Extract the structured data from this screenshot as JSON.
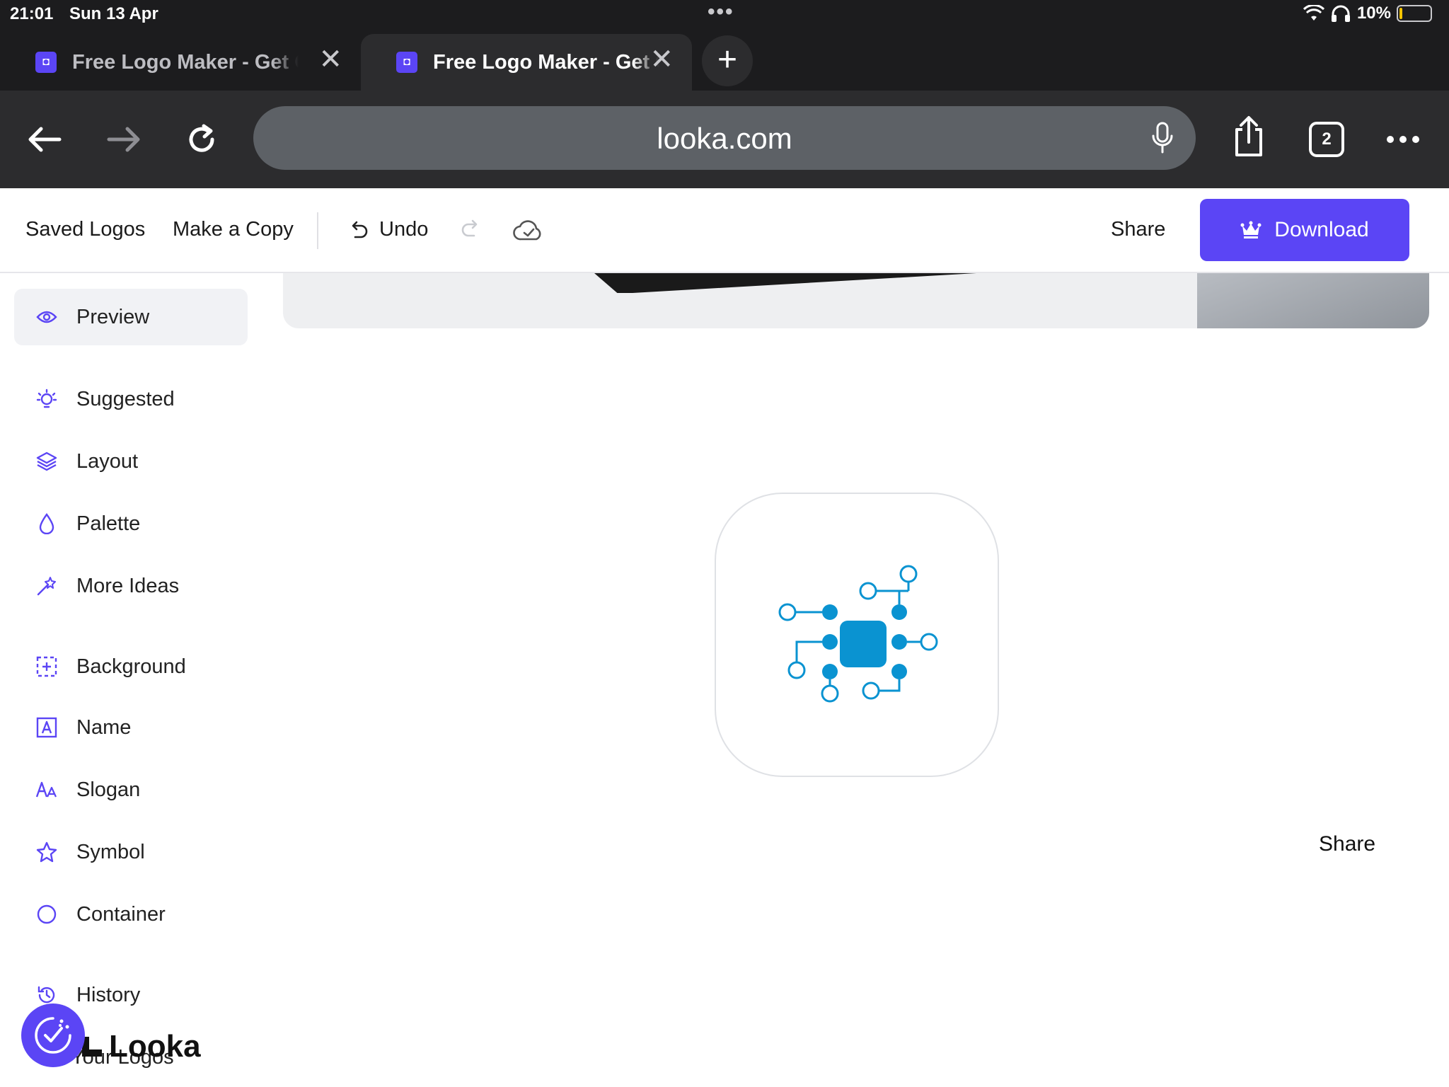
{
  "status_bar": {
    "time": "21:01",
    "date": "Sun 13 Apr",
    "battery": "10%",
    "battery_level": 0.1
  },
  "tabs": [
    {
      "title": "Free Logo Maker - Get C",
      "active": false
    },
    {
      "title": "Free Logo Maker - Get C",
      "active": true
    }
  ],
  "toolbar": {
    "address": "looka.com",
    "tab_count": "2"
  },
  "app_bar": {
    "saved_logos": "Saved Logos",
    "make_copy": "Make a Copy",
    "undo": "Undo",
    "share": "Share",
    "download": "Download"
  },
  "sidebar": {
    "items": [
      {
        "label": "Preview",
        "icon": "eye-icon",
        "active": true
      },
      {
        "label": "Suggested",
        "icon": "lightbulb-icon"
      },
      {
        "label": "Layout",
        "icon": "layers-icon"
      },
      {
        "label": "Palette",
        "icon": "drop-icon"
      },
      {
        "label": "More Ideas",
        "icon": "magic-wand-icon"
      },
      {
        "label": "Background",
        "icon": "background-grid-icon"
      },
      {
        "label": "Name",
        "icon": "text-box-icon"
      },
      {
        "label": "Slogan",
        "icon": "font-size-icon"
      },
      {
        "label": "Symbol",
        "icon": "star-icon"
      },
      {
        "label": "Container",
        "icon": "circle-icon"
      },
      {
        "label": "History",
        "icon": "history-icon"
      },
      {
        "label": "Your Logos",
        "icon": "logo-icon"
      }
    ]
  },
  "canvas": {
    "share_label": "Share",
    "logo_color": "#0a93d1",
    "logo_icon": "circuit-chip-icon"
  },
  "brand": {
    "name": "Looka"
  },
  "colors": {
    "accent": "#5b45f5",
    "chrome_dark": "#1c1c1e",
    "chrome_mid": "#2c2c2e"
  }
}
